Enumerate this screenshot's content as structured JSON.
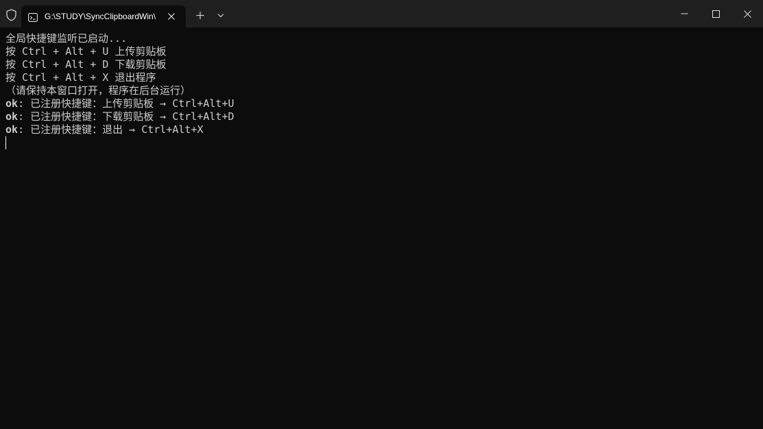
{
  "tab": {
    "title": "G:\\STUDY\\SyncClipboardWin\\"
  },
  "icons": {
    "shield": "shield-icon",
    "terminal": "terminal-icon",
    "close_tab": "close-icon",
    "new_tab": "plus-icon",
    "dropdown": "chevron-down-icon",
    "minimize": "minimize-icon",
    "maximize": "maximize-icon",
    "close_window": "close-icon"
  },
  "terminal": {
    "lines": [
      "全局快捷键监听已启动...",
      "按 Ctrl + Alt + U 上传剪贴板",
      "按 Ctrl + Alt + D 下载剪贴板",
      "按 Ctrl + Alt + X 退出程序",
      "（请保持本窗口打开，程序在后台运行）"
    ],
    "ok_lines": [
      {
        "prefix": "ok",
        "text": ": 已注册快捷键：上传剪贴板 → Ctrl+Alt+U"
      },
      {
        "prefix": "ok",
        "text": ": 已注册快捷键：下载剪贴板 → Ctrl+Alt+D"
      },
      {
        "prefix": "ok",
        "text": ": 已注册快捷键：退出 → Ctrl+Alt+X"
      }
    ]
  },
  "colors": {
    "background": "#0c0c0c",
    "titlebar": "#1f1f1f",
    "text": "#cccccc"
  }
}
